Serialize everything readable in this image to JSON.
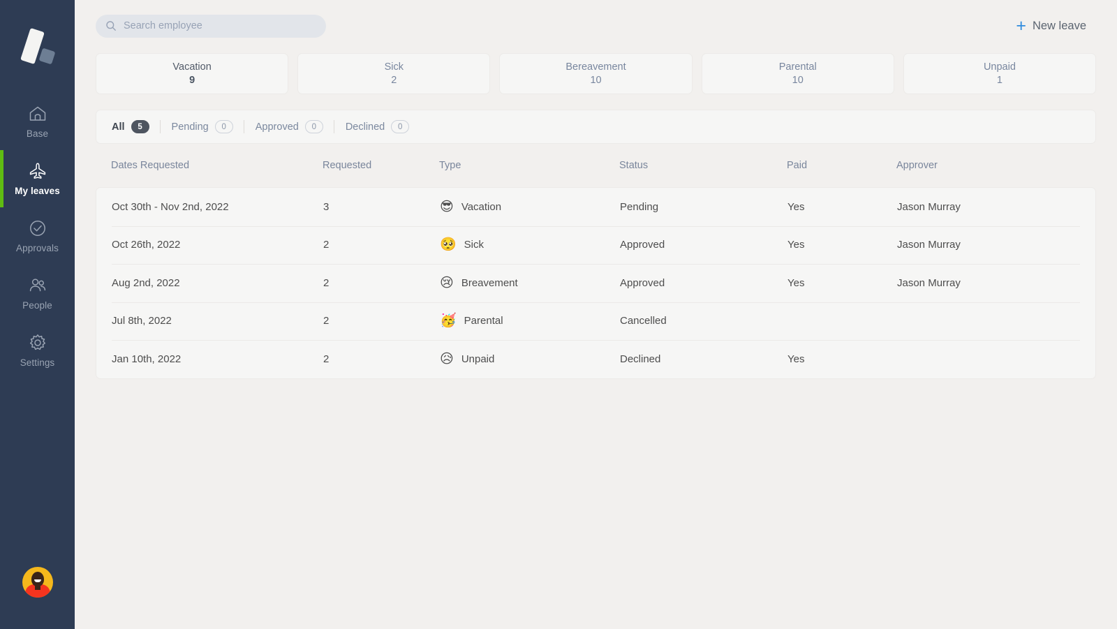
{
  "theme": {
    "sidebar_bg": "#2e3c54",
    "page_bg": "#f2f0ee",
    "card_bg": "#f6f6f5",
    "accent_green": "#5fbc12",
    "accent_blue": "#2f8bdd",
    "muted_text": "#78869e"
  },
  "sidebar": {
    "logo_name": "company-logo",
    "items": [
      {
        "label": "Base",
        "icon": "home-icon",
        "active": false
      },
      {
        "label": "My leaves",
        "icon": "airplane-icon",
        "active": true
      },
      {
        "label": "Approvals",
        "icon": "check-circle-icon",
        "active": false
      },
      {
        "label": "People",
        "icon": "people-icon",
        "active": false
      },
      {
        "label": "Settings",
        "icon": "gear-icon",
        "active": false
      }
    ],
    "avatar_alt": "user-avatar"
  },
  "topbar": {
    "search": {
      "icon": "search-icon",
      "placeholder": "Search employee",
      "value": ""
    },
    "new_leave": {
      "icon": "plus-icon",
      "symbol": "+",
      "label": "New leave"
    }
  },
  "stats": [
    {
      "title": "Vacation",
      "value": "9",
      "primary": true
    },
    {
      "title": "Sick",
      "value": "2",
      "primary": false
    },
    {
      "title": "Bereavement",
      "value": "10",
      "primary": false
    },
    {
      "title": "Parental",
      "value": "10",
      "primary": false
    },
    {
      "title": "Unpaid",
      "value": "1",
      "primary": false
    }
  ],
  "filters": [
    {
      "label": "All",
      "count": "5",
      "active": true
    },
    {
      "label": "Pending",
      "count": "0",
      "active": false
    },
    {
      "label": "Approved",
      "count": "0",
      "active": false
    },
    {
      "label": "Declined",
      "count": "0",
      "active": false
    }
  ],
  "table": {
    "columns": [
      "Dates Requested",
      "Requested",
      "Type",
      "Status",
      "Paid",
      "Approver"
    ],
    "rows": [
      {
        "dates": "Oct 30th - Nov 2nd, 2022",
        "requested": "3",
        "emoji": "😎",
        "type": "Vacation",
        "status": "Pending",
        "paid": "Yes",
        "approver": "Jason Murray"
      },
      {
        "dates": "Oct 26th, 2022",
        "requested": "2",
        "emoji": "🥺",
        "type": "Sick",
        "status": "Approved",
        "paid": "Yes",
        "approver": "Jason Murray"
      },
      {
        "dates": "Aug 2nd, 2022",
        "requested": "2",
        "emoji": "😢",
        "type": "Breavement",
        "status": "Approved",
        "paid": "Yes",
        "approver": "Jason Murray"
      },
      {
        "dates": "Jul 8th, 2022",
        "requested": "2",
        "emoji": "🥳",
        "type": "Parental",
        "status": "Cancelled",
        "paid": "",
        "approver": ""
      },
      {
        "dates": "Jan 10th, 2022",
        "requested": "2",
        "emoji": "😥",
        "type": "Unpaid",
        "status": "Declined",
        "paid": "Yes",
        "approver": ""
      }
    ]
  }
}
